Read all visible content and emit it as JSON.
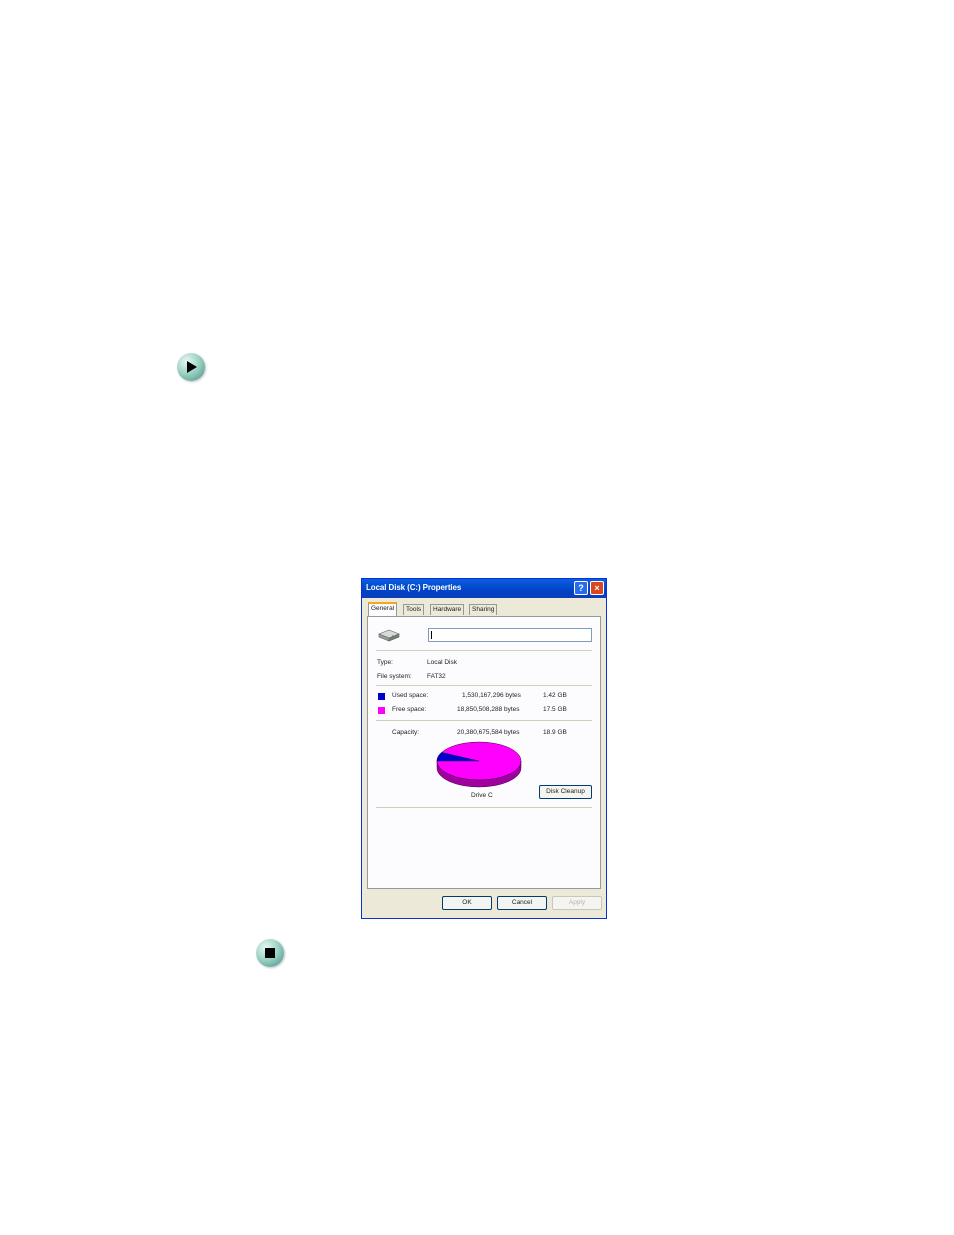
{
  "dialog": {
    "title": "Local Disk (C:) Properties",
    "help_glyph": "?",
    "close_glyph": "×",
    "tabs": [
      "General",
      "Tools",
      "Hardware",
      "Sharing"
    ],
    "active_tab": "General",
    "name_value": "",
    "type_label": "Type:",
    "type_value": "Local Disk",
    "fs_label": "File system:",
    "fs_value": "FAT32",
    "used": {
      "label": "Used space:",
      "bytes": "1,530,167,296 bytes",
      "size": "1.42 GB",
      "color": "#0000cc"
    },
    "free": {
      "label": "Free space:",
      "bytes": "18,850,508,288 bytes",
      "size": "17.5 GB",
      "color": "#ff00ff"
    },
    "capacity": {
      "label": "Capacity:",
      "bytes": "20,380,675,584 bytes",
      "size": "18.9 GB"
    },
    "drive_label": "Drive C",
    "cleanup_label": "Disk Cleanup",
    "ok_label": "OK",
    "cancel_label": "Cancel",
    "apply_label": "Apply",
    "used_fraction": 0.075
  },
  "icons": {
    "start": "arrow-right-icon",
    "end": "stop-square-icon"
  }
}
